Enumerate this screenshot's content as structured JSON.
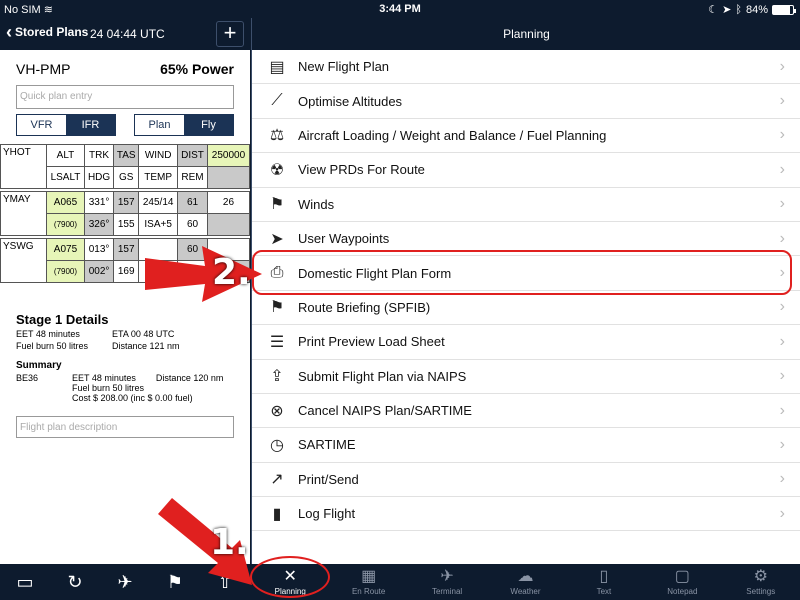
{
  "status_bar": {
    "carrier": "No SIM",
    "wifi_icon": "wifi-icon",
    "time": "3:44 PM",
    "battery": "84%",
    "battery_level": 0.84
  },
  "left_panel": {
    "back_label": "Stored Plans",
    "nav_time": "24 04:44 UTC",
    "add_icon": "+",
    "registration": "VH-PMP",
    "power": "65% Power",
    "quick_entry_placeholder": "Quick plan entry",
    "rules_segment": [
      "VFR",
      "IFR"
    ],
    "rules_selected": "IFR",
    "mode_segment": [
      "Plan",
      "Fly"
    ],
    "mode_selected": "Fly",
    "nav_log": {
      "origin": "YHOT",
      "header_row1": [
        "ALT",
        "TRK",
        "TAS",
        "WIND",
        "DIST",
        "250000"
      ],
      "header_row2": [
        "LSALT",
        "HDG",
        "GS",
        "TEMP",
        "REM",
        ""
      ],
      "legs": [
        {
          "waypoint": "YMAY",
          "row1": [
            "A065",
            "331°",
            "157",
            "245/14",
            "61",
            "26"
          ],
          "row2": [
            "(7900)",
            "326°",
            "155",
            "ISA+5",
            "60",
            ""
          ]
        },
        {
          "waypoint": "YSWG",
          "row1": [
            "A075",
            "013°",
            "157",
            "",
            "60",
            ""
          ],
          "row2": [
            "(7900)",
            "002°",
            "169",
            "",
            "",
            ""
          ]
        }
      ]
    },
    "stage": {
      "title": "Stage 1 Details",
      "eet": "EET 48 minutes",
      "eta": "ETA 00 48 UTC",
      "fuel": "Fuel burn 50 litres",
      "distance": "Distance 121 nm"
    },
    "summary": {
      "title": "Summary",
      "aircraft": "BE36",
      "eet": "EET 48 minutes",
      "distance": "Distance 120 nm",
      "fuel": "Fuel burn 50 litres",
      "cost": "Cost $ 208.00 (inc $ 0.00 fuel)"
    },
    "description_placeholder": "Flight plan description",
    "toolbar_icons": [
      "folder-icon",
      "refresh-icon",
      "airplane-icon",
      "flag-icon",
      "share-icon"
    ]
  },
  "right_panel": {
    "title": "Planning",
    "menu": [
      {
        "label": "New Flight Plan",
        "icon": "new-plan-icon"
      },
      {
        "label": "Optimise Altitudes",
        "icon": "altitude-graph-icon"
      },
      {
        "label": "Aircraft Loading / Weight and Balance / Fuel Planning",
        "icon": "scales-icon"
      },
      {
        "label": "View PRDs For Route",
        "icon": "radiation-icon"
      },
      {
        "label": "Winds",
        "icon": "windsock-icon"
      },
      {
        "label": "User Waypoints",
        "icon": "location-arrow-icon"
      },
      {
        "label": "Domestic Flight Plan Form",
        "icon": "printer-icon"
      },
      {
        "label": "Route Briefing (SPFIB)",
        "icon": "flag-icon"
      },
      {
        "label": "Print Preview Load Sheet",
        "icon": "document-icon"
      },
      {
        "label": "Submit Flight Plan via NAIPS",
        "icon": "inbox-upload-icon"
      },
      {
        "label": "Cancel NAIPS Plan/SARTIME",
        "icon": "cancel-circle-icon"
      },
      {
        "label": "SARTIME",
        "icon": "clock-icon"
      },
      {
        "label": "Print/Send",
        "icon": "share-arrow-icon"
      },
      {
        "label": "Log Flight",
        "icon": "logbook-icon"
      }
    ]
  },
  "tab_bar": [
    {
      "label": "Planning",
      "icon": "route-plan-icon",
      "active": true
    },
    {
      "label": "En Route",
      "icon": "map-icon",
      "active": false
    },
    {
      "label": "Terminal",
      "icon": "airplane-icon",
      "active": false
    },
    {
      "label": "Weather",
      "icon": "cloud-lightning-icon",
      "active": false
    },
    {
      "label": "Text",
      "icon": "book-icon",
      "active": false
    },
    {
      "label": "Notepad",
      "icon": "notepad-icon",
      "active": false
    },
    {
      "label": "Settings",
      "icon": "gear-icon",
      "active": false
    }
  ],
  "annotations": [
    {
      "number": "1.",
      "color": "#e0201f",
      "target": "Planning tab"
    },
    {
      "number": "2.",
      "color": "#e0201f",
      "target": "Domestic Flight Plan Form"
    }
  ]
}
